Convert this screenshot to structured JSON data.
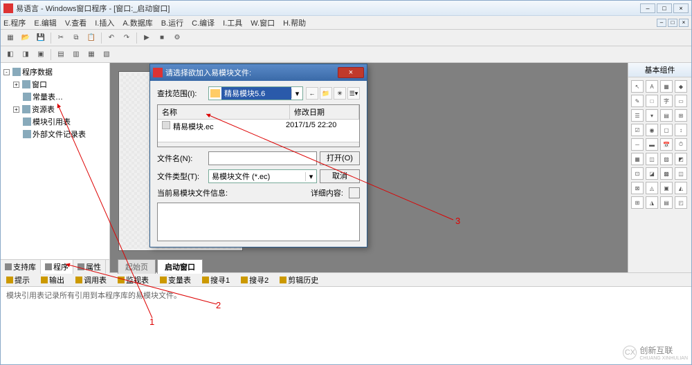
{
  "titlebar": {
    "text": "易语言 - Windows窗口程序 - [窗口:_启动窗口]"
  },
  "menubar": {
    "items": [
      "E.程序",
      "E.编辑",
      "V.查看",
      "I.插入",
      "A.数据库",
      "B.运行",
      "C.编译",
      "I.工具",
      "W.窗口",
      "H.帮助"
    ]
  },
  "tree": {
    "root": "程序数据",
    "items": [
      "窗口",
      "常量表…",
      "资源表",
      "模块引用表",
      "外部文件记录表"
    ]
  },
  "left_tabs": [
    "支持库",
    "程序",
    "属性"
  ],
  "center_tabs": [
    "起始页",
    "启动窗口"
  ],
  "right_panel": {
    "title": "基本组件"
  },
  "bottom_tabs": [
    "提示",
    "输出",
    "调用表",
    "监视表",
    "变量表",
    "搜寻1",
    "搜寻2",
    "剪辑历史"
  ],
  "bottom_text": "模块引用表记录所有引用到本程序库的易模块文件。",
  "dialog": {
    "title": "请选择欲加入易模块文件:",
    "lookin_label": "查找范围(I):",
    "lookin_value": "精易模块5.6",
    "hdr_name": "名称",
    "hdr_date": "修改日期",
    "file_name": "精易模块.ec",
    "file_date": "2017/1/5 22:20",
    "filename_label": "文件名(N):",
    "filename_value": "",
    "filetype_label": "文件类型(T):",
    "filetype_value": "易模块文件 (*.ec)",
    "open_btn": "打开(O)",
    "cancel_btn": "取消",
    "info_label": "当前易模块文件信息:",
    "detail_label": "详细内容:"
  },
  "annotations": {
    "a1": "1",
    "a2": "2",
    "a3": "3"
  },
  "watermark": {
    "name": "创新互联",
    "sub": "CHUANG XINHULIAN"
  }
}
